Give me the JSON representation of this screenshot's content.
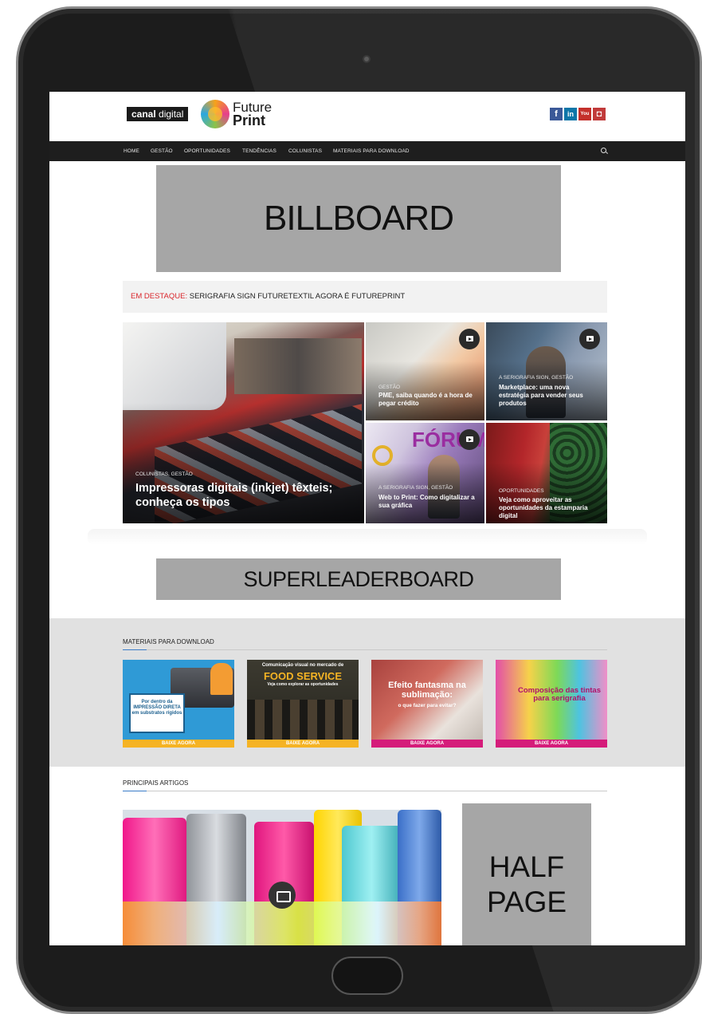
{
  "site": {
    "logo_canal_bold": "canal",
    "logo_canal_thin": "digital",
    "logo_future": "Future",
    "logo_print": "Print"
  },
  "social": [
    "f",
    "in",
    "You",
    "◘"
  ],
  "nav": {
    "items": [
      "HOME",
      "GESTÃO",
      "OPORTUNIDADES",
      "TENDÊNCIAS",
      "COLUNISTAS",
      "MATERIAIS PARA DOWNLOAD"
    ]
  },
  "ads": {
    "billboard": "BILLBOARD",
    "superleaderboard": "SUPERLEADERBOARD",
    "half_page_line1": "HALF",
    "half_page_line2": "PAGE"
  },
  "ticker": {
    "label": "EM DESTAQUE:",
    "text": "SERIGRAFIA SIGN FUTURETEXTIL AGORA É FUTUREPRINT"
  },
  "featured": [
    {
      "category": "COLUNISTAS, GESTÃO",
      "title": "Impressoras digitais (inkjet) têxteis; conheça os tipos"
    },
    {
      "category": "GESTÃO",
      "title": "PME, saiba quando é a hora de pegar crédito"
    },
    {
      "category": "A SERIGRAFIA SIGN, GESTÃO",
      "title": "Marketplace: uma nova estratégia para vender seus produtos"
    },
    {
      "category": "A SERIGRAFIA SIGN, GESTÃO",
      "title": "Web to Print: Como digitalizar a sua gráfica"
    },
    {
      "category": "OPORTUNIDADES",
      "title": "Veja como aproveitar as oportunidades da estamparia digital"
    }
  ],
  "downloads": {
    "section_title": "MATERIAIS PARA DOWNLOAD",
    "items": [
      {
        "caption": "Por dentro da IMPRESSÃO DIRETA em substratos rígidos",
        "button": "BAIXE AGORA"
      },
      {
        "caption_top": "Comunicação visual no mercado de",
        "caption_main": "FOOD SERVICE",
        "caption_sub": "Veja como explorar as oportunidades",
        "button": "BAIXE AGORA"
      },
      {
        "caption_main": "Efeito fantasma na sublimação:",
        "caption_sub": "o que fazer para evitar?",
        "button": "BAIXE AGORA"
      },
      {
        "caption_main": "Composição das tintas para serigrafia",
        "button": "BAIXE AGORA"
      }
    ]
  },
  "articles": {
    "section_title": "PRINCIPAIS ARTIGOS"
  },
  "colors": {
    "nav_bg": "#1e1e1e",
    "ad_gray": "#a6a6a6",
    "ticker_label": "#d9252b",
    "dl_yellow": "#f5b324",
    "dl_magenta": "#d51c7a",
    "facebook": "#3b5998",
    "linkedin": "#0e76a8",
    "youtube": "#c4302b",
    "instagram": "#c13a3a"
  }
}
